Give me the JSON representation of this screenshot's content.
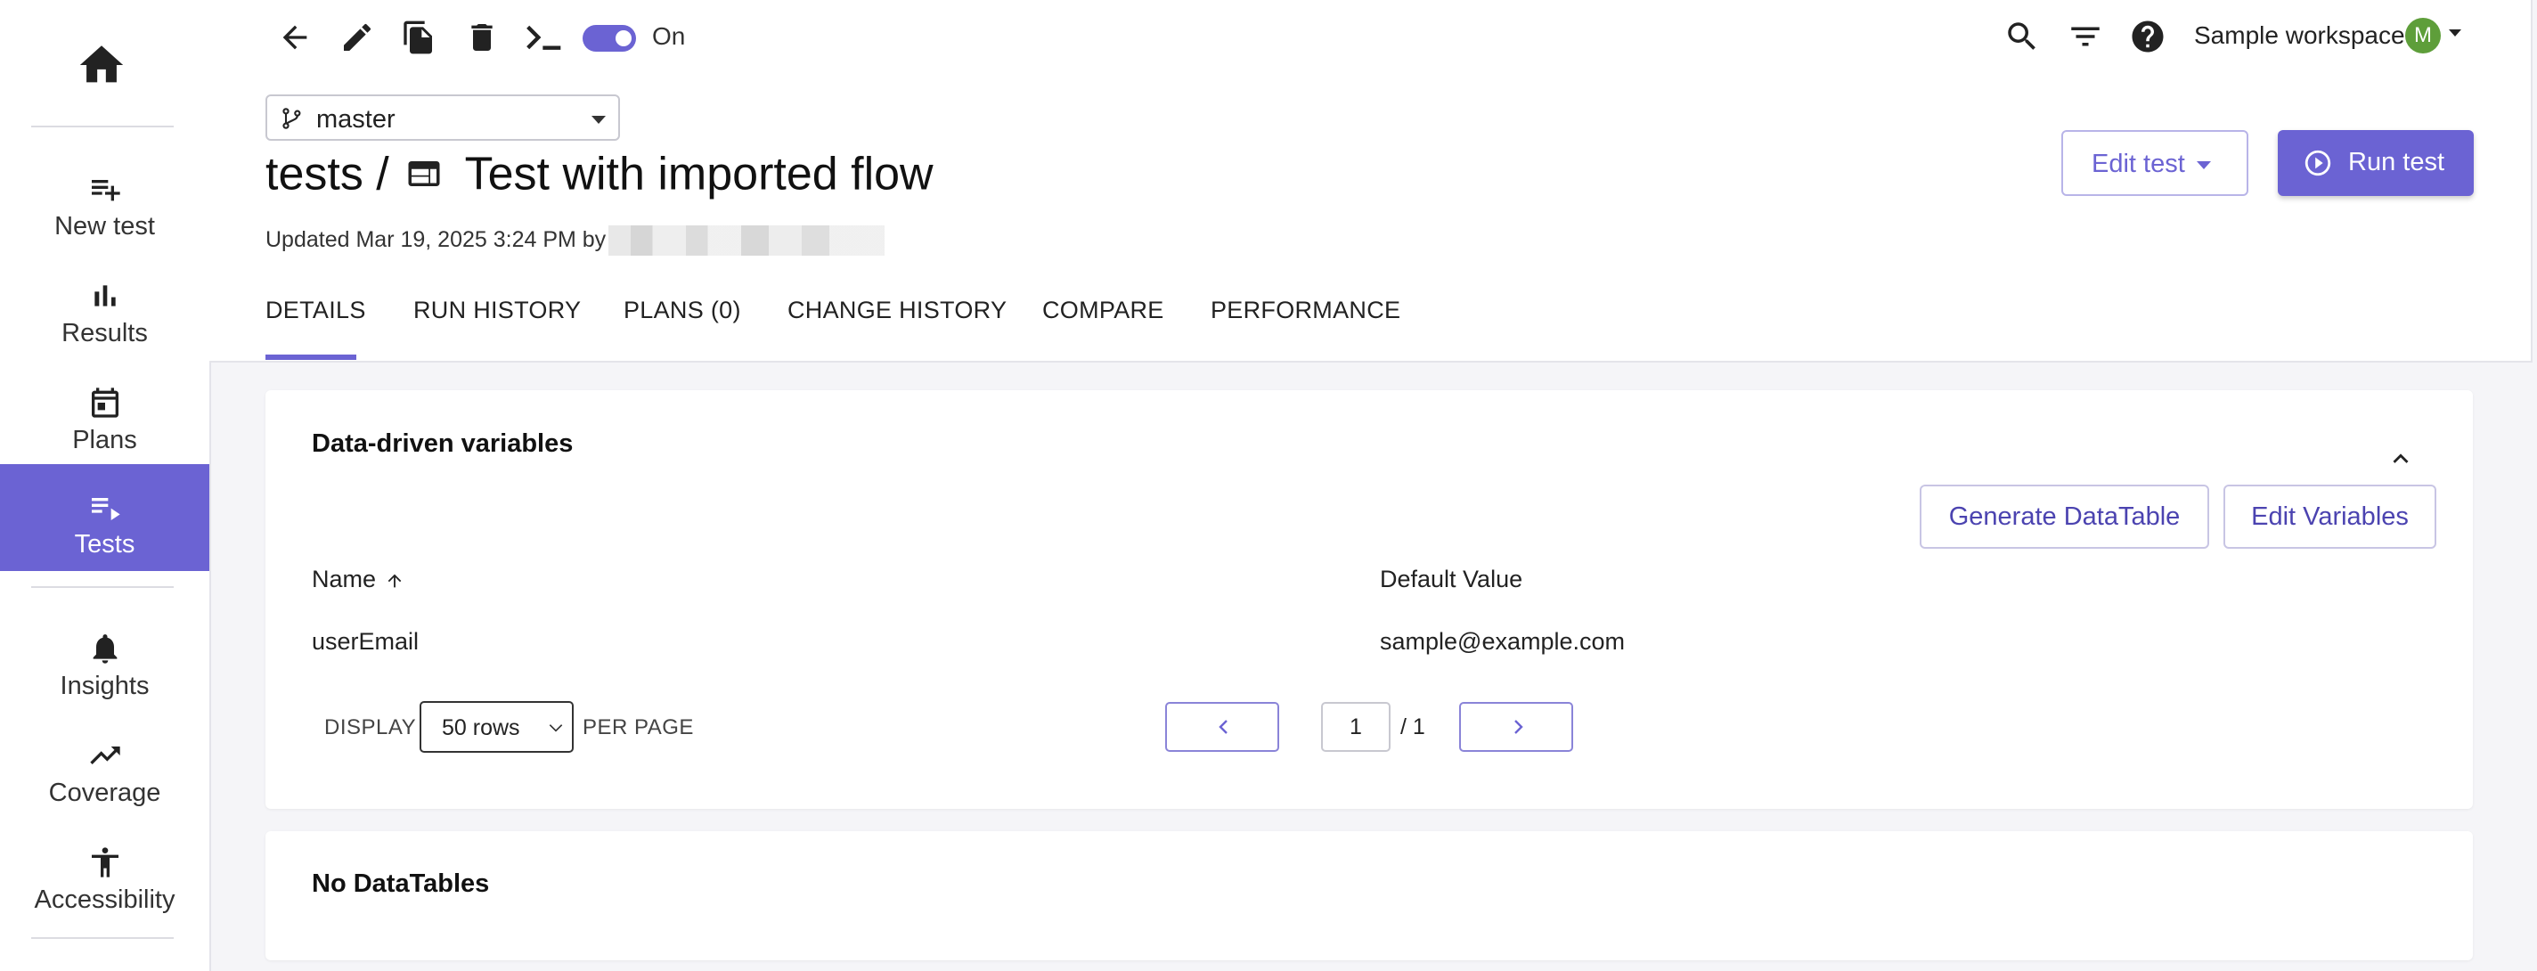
{
  "sidebar": {
    "items": [
      {
        "label": "New test",
        "icon": "playlist-add-icon"
      },
      {
        "label": "Results",
        "icon": "bar-chart-icon"
      },
      {
        "label": "Plans",
        "icon": "calendar-icon"
      },
      {
        "label": "Tests",
        "icon": "playlist-play-icon",
        "active": true
      },
      {
        "label": "Insights",
        "icon": "bell-icon"
      },
      {
        "label": "Coverage",
        "icon": "trending-up-icon"
      },
      {
        "label": "Accessibility",
        "icon": "accessibility-icon"
      }
    ]
  },
  "toolbar": {
    "toggle_label": "On",
    "icons": [
      "back-arrow-icon",
      "edit-pencil-icon",
      "copy-icon",
      "delete-icon",
      "terminal-icon"
    ]
  },
  "header": {
    "branch": "master",
    "title_prefix": "tests /",
    "title": "Test with imported flow",
    "updated": "Updated Mar 19, 2025 3:24 PM by",
    "workspace": "Sample workspace",
    "avatar_letter": "M",
    "edit_test_label": "Edit test",
    "run_test_label": "Run test"
  },
  "tabs": [
    "DETAILS",
    "RUN HISTORY",
    "PLANS (0)",
    "CHANGE HISTORY",
    "COMPARE",
    "PERFORMANCE"
  ],
  "variables_card": {
    "title": "Data-driven variables",
    "generate_label": "Generate DataTable",
    "edit_label": "Edit Variables",
    "columns": [
      "Name",
      "Default Value"
    ],
    "rows": [
      {
        "name": "userEmail",
        "default_value": "sample@example.com"
      }
    ],
    "pagination": {
      "display_label": "DISPLAY",
      "rows_option": "50 rows",
      "per_page_label": "PER PAGE",
      "page": "1",
      "total": "/ 1"
    }
  },
  "datatables_card": {
    "title": "No DataTables"
  },
  "colors": {
    "accent": "#6b63d3",
    "avatar": "#5e9e3a"
  }
}
